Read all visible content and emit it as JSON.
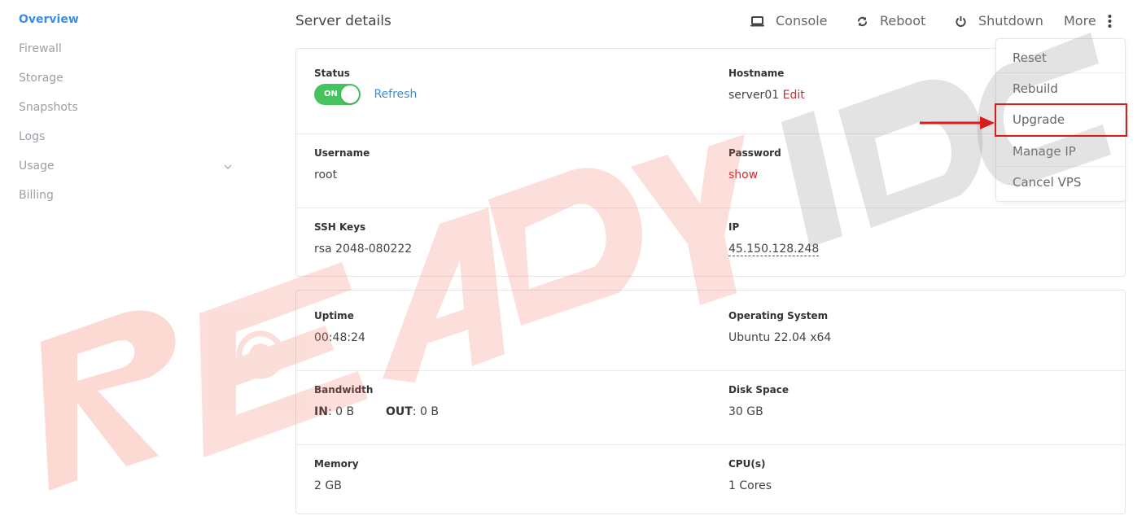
{
  "sidebar": {
    "items": [
      {
        "label": "Overview",
        "active": true
      },
      {
        "label": "Firewall"
      },
      {
        "label": "Storage"
      },
      {
        "label": "Snapshots"
      },
      {
        "label": "Logs"
      },
      {
        "label": "Usage",
        "has_submenu": true
      },
      {
        "label": "Billing"
      }
    ]
  },
  "header": {
    "title": "Server details",
    "actions": {
      "console": "Console",
      "reboot": "Reboot",
      "shutdown": "Shutdown",
      "more": "More"
    }
  },
  "dropdown": {
    "items": [
      "Reset",
      "Rebuild",
      "Upgrade",
      "Manage IP",
      "Cancel VPS"
    ],
    "highlighted": "Upgrade"
  },
  "details": {
    "status": {
      "label": "Status",
      "toggle": "ON",
      "refresh": "Refresh"
    },
    "hostname": {
      "label": "Hostname",
      "value": "server01",
      "edit": "Edit"
    },
    "username": {
      "label": "Username",
      "value": "root"
    },
    "password": {
      "label": "Password",
      "show": "show"
    },
    "ssh_keys": {
      "label": "SSH Keys",
      "value": "rsa 2048-080222"
    },
    "ip": {
      "label": "IP",
      "value": "45.150.128.248"
    }
  },
  "resources": {
    "uptime": {
      "label": "Uptime",
      "value": "00:48:24"
    },
    "os": {
      "label": "Operating System",
      "value": "Ubuntu 22.04 x64"
    },
    "bandwidth": {
      "label": "Bandwidth",
      "in_label": "IN",
      "in_value": ": 0 B",
      "out_label": "OUT",
      "out_value": ": 0 B"
    },
    "disk": {
      "label": "Disk Space",
      "value": "30 GB"
    },
    "memory": {
      "label": "Memory",
      "value": "2 GB"
    },
    "cpu": {
      "label": "CPU(s)",
      "value": "1 Cores"
    }
  },
  "colors": {
    "accent": "#3a8ee6",
    "toggle_on": "#46c35f",
    "danger": "#d9262e",
    "annotation": "#d91c1c"
  },
  "watermark": {
    "text": "READYIDC"
  }
}
